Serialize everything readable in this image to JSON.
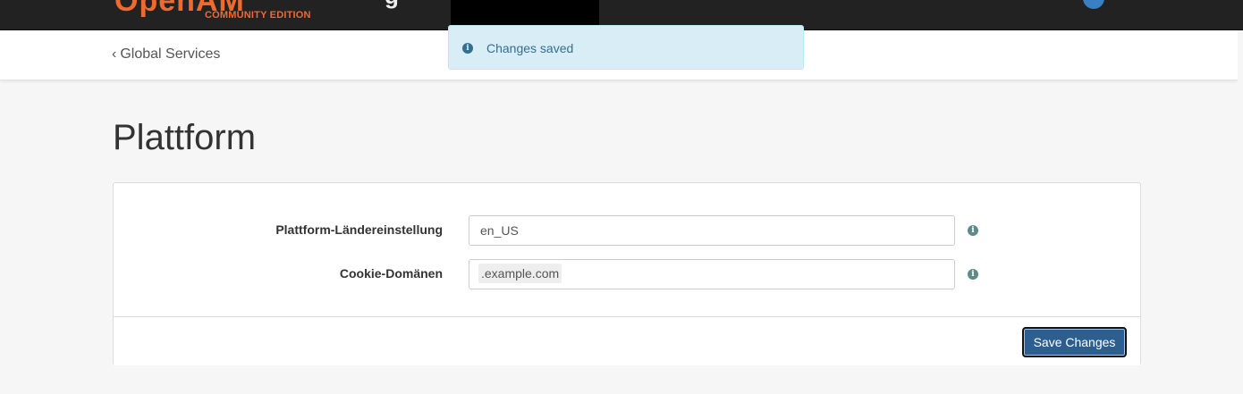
{
  "navbar": {
    "logo_text": "OpenAM",
    "edition": "COMMUNITY EDITION",
    "brand_fragment": "g"
  },
  "breadcrumb": {
    "chevron": "‹",
    "label": "Global Services"
  },
  "alert": {
    "icon": "info-icon",
    "message": "Changes saved",
    "color": "#31708f",
    "background": "#d9edf7"
  },
  "page": {
    "title": "Plattform"
  },
  "form": {
    "fields": [
      {
        "label": "Plattform-Ländereinstellung",
        "value": "en_US",
        "help_icon": "info-icon"
      },
      {
        "label": "Cookie-Domänen",
        "value": "",
        "tags": [
          ".example.com"
        ],
        "help_icon": "info-icon"
      }
    ],
    "save_label": "Save Changes"
  },
  "colors": {
    "accent": "#ef6a2f",
    "primary_button": "#2c5e8f",
    "navbar": "#222222"
  }
}
